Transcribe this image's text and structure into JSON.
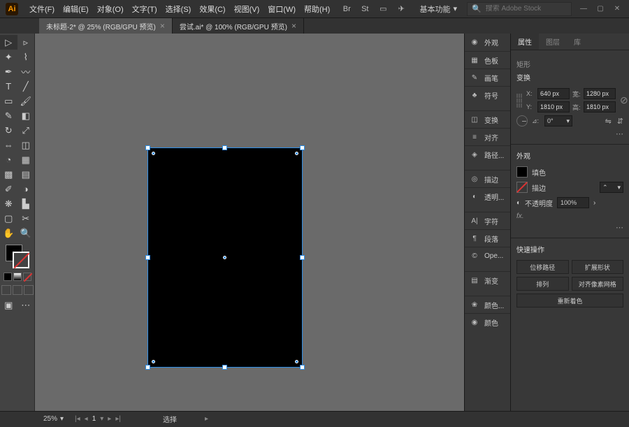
{
  "app": {
    "logo": "Ai",
    "workspace": "基本功能",
    "search_placeholder": "搜索 Adobe Stock"
  },
  "menu": [
    "文件(F)",
    "编辑(E)",
    "对象(O)",
    "文字(T)",
    "选择(S)",
    "效果(C)",
    "视图(V)",
    "窗口(W)",
    "帮助(H)"
  ],
  "tabs": [
    {
      "label": "未标题-2* @ 25% (RGB/GPU 预览)",
      "active": true
    },
    {
      "label": "尝试.ai* @ 100% (RGB/GPU 预览)",
      "active": false
    }
  ],
  "dock": [
    {
      "icon": "◉",
      "label": "外观"
    },
    {
      "icon": "▦",
      "label": "色板"
    },
    {
      "icon": "✎",
      "label": "画笔"
    },
    {
      "icon": "♣",
      "label": "符号"
    },
    {
      "gap": true
    },
    {
      "icon": "◫",
      "label": "变换"
    },
    {
      "icon": "≡",
      "label": "对齐"
    },
    {
      "icon": "◈",
      "label": "路径..."
    },
    {
      "gap": true
    },
    {
      "icon": "◎",
      "label": "描边"
    },
    {
      "icon": "◐",
      "label": "透明..."
    },
    {
      "gap": true
    },
    {
      "icon": "A|",
      "label": "字符"
    },
    {
      "icon": "¶",
      "label": "段落"
    },
    {
      "icon": "©",
      "label": "Ope..."
    },
    {
      "gap": true
    },
    {
      "icon": "▤",
      "label": "渐变"
    },
    {
      "gap": true
    },
    {
      "icon": "❀",
      "label": "颜色..."
    },
    {
      "icon": "◉",
      "label": "颜色"
    }
  ],
  "panel": {
    "tabs": [
      "属性",
      "图层",
      "库"
    ],
    "shape_label": "矩形",
    "transform_title": "变换",
    "x_label": "X:",
    "x_val": "640 px",
    "w_label": "宽:",
    "w_val": "1280 px",
    "y_label": "Y:",
    "y_val": "1810 px",
    "h_label": "高:",
    "h_val": "1810 px",
    "rot_label": "⊿:",
    "rot_val": "0°",
    "appearance_title": "外观",
    "fill_label": "填色",
    "stroke_label": "描边",
    "stroke_dd": "",
    "opacity_label": "不透明度",
    "opacity_val": "100%",
    "fx_label": "fx.",
    "quick_title": "快速操作",
    "quick": [
      "位移路径",
      "扩展形状",
      "排列",
      "对齐像素网格",
      "重新着色"
    ]
  },
  "status": {
    "zoom": "25%",
    "page": "1",
    "mode": "选择"
  }
}
